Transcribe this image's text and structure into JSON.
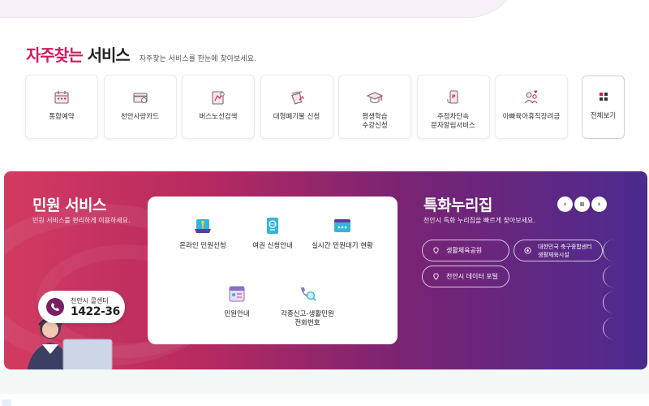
{
  "frequent_services": {
    "title_accent": "자주찾는",
    "title_rest": "서비스",
    "subtitle": "자주찾는 서비스를 한눈에 찾아보세요.",
    "items": [
      {
        "label": "통합예약",
        "icon": "calendar-icon"
      },
      {
        "label": "천안사랑카드",
        "icon": "card-icon"
      },
      {
        "label": "버스노선검색",
        "icon": "bus-route-icon"
      },
      {
        "label": "대형폐기물 신청",
        "icon": "waste-icon"
      },
      {
        "label": "평생학습\n수강신청",
        "icon": "graduation-icon"
      },
      {
        "label": "주정차단속\n문자알림서비스",
        "icon": "parking-alert-icon"
      },
      {
        "label": "아빠육아휴직장려금",
        "icon": "family-icon"
      }
    ],
    "view_all_label": "전체보기"
  },
  "civil_service": {
    "title": "민원 서비스",
    "subtitle": "민원 서비스를 편리하게 이용하세요.",
    "items": [
      {
        "label": "온라인 민원신청",
        "icon": "online-petition-icon"
      },
      {
        "label": "여권 신청안내",
        "icon": "passport-icon"
      },
      {
        "label": "실시간 민원대기 현황",
        "icon": "waiting-status-icon"
      },
      {
        "label": "민원안내",
        "icon": "petition-guide-icon"
      },
      {
        "label": "각종신고-생활민원\n전화번호",
        "icon": "phone-search-icon"
      }
    ],
    "call_center": {
      "name": "천안시 콜센터",
      "number": "1422-36"
    }
  },
  "special_sites": {
    "title": "특화누리집",
    "subtitle": "천안시 특화 누리집을 빠르게 찾아보세요.",
    "controls": {
      "prev": "‹",
      "pause": "II",
      "next": "›"
    },
    "items": [
      {
        "label": "생활체육공원",
        "icon": "location-pin-icon"
      },
      {
        "label": "대한민국 축구종합센터\n생활체육시설",
        "icon": "soccer-ball-icon"
      },
      {
        "label": "천안시 데이터 포털",
        "icon": "location-pin-icon"
      }
    ]
  },
  "colors": {
    "accent": "#d3195c",
    "band_start": "#d23b61",
    "band_end": "#4b2b8f",
    "call_icon": "#7a1f63"
  }
}
